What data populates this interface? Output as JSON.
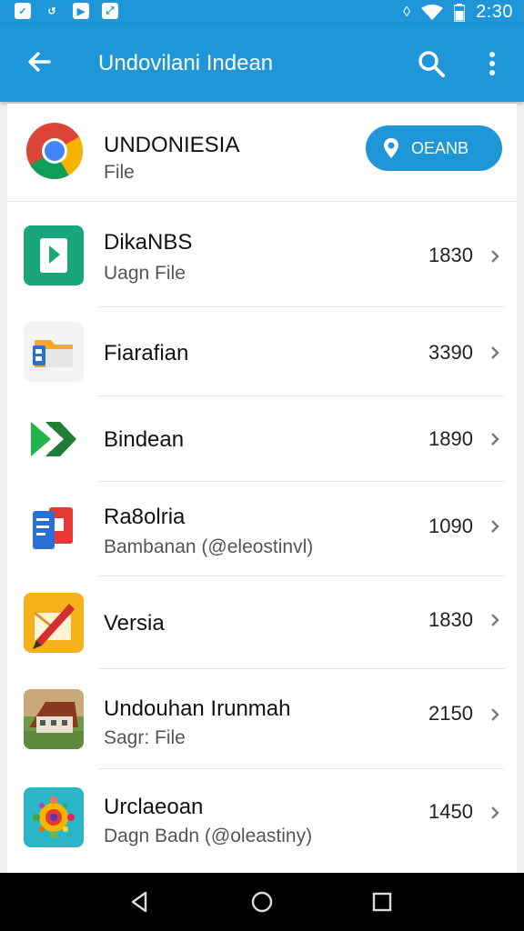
{
  "status_bar": {
    "time": "2:30",
    "left_icons": [
      "notification-icon-1",
      "notification-icon-2",
      "notification-icon-3",
      "notification-icon-4"
    ],
    "right_icons": [
      "vibrate-icon",
      "wifi-icon",
      "battery-icon"
    ]
  },
  "app_bar": {
    "title": "Undovilani Indean",
    "back_icon": "arrow-left-icon",
    "search_icon": "search-icon",
    "more_icon": "more-vert-icon",
    "color": "#1e96d8"
  },
  "header": {
    "title": "UNDONIESIA",
    "subtitle": "File",
    "button_label": "OEANB",
    "button_icon": "location-pin-icon"
  },
  "items": [
    {
      "name": "DikaNBS",
      "subtitle": "Uagn File",
      "value": "1830",
      "icon": "app-green-icon"
    },
    {
      "name": "Fiarafian",
      "subtitle": "",
      "value": "3390",
      "icon": "folder-icon"
    },
    {
      "name": "Bindean",
      "subtitle": "",
      "value": "1890",
      "icon": "play-arrow-icon"
    },
    {
      "name": "Ra8olria",
      "subtitle": "Bambanan (@eleostinvl)",
      "value": "1090",
      "icon": "document-icon"
    },
    {
      "name": "Versia",
      "subtitle": "",
      "value": "1830",
      "icon": "pencil-icon"
    },
    {
      "name": "Undouhan Irunmah",
      "subtitle": "Sagr: File",
      "value": "2150",
      "icon": "house-photo-icon"
    },
    {
      "name": "Urclaeoan",
      "subtitle": "Dagn Badn (@oleastiny)",
      "value": "1450",
      "icon": "gallery-icon"
    }
  ],
  "nav_bar": {
    "back_icon": "nav-back-icon",
    "home_icon": "nav-home-icon",
    "recents_icon": "nav-recents-icon"
  }
}
